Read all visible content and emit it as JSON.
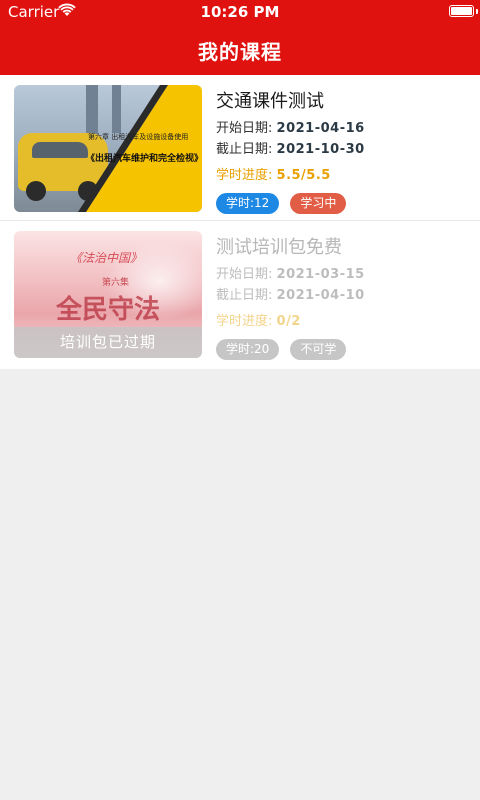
{
  "status_bar": {
    "carrier": "Carrier",
    "time": "10:26 PM"
  },
  "nav": {
    "title": "我的课程"
  },
  "colors": {
    "brand_red": "#e0120f",
    "hours_tag": "#1e88e5",
    "status_tag": "#e25d45",
    "progress": "#e9a100",
    "disabled": "#c6c6c6"
  },
  "courses": [
    {
      "title": "交通课件测试",
      "start_label": "开始日期:",
      "start_date": "2021-04-16",
      "end_label": "截止日期:",
      "end_date": "2021-10-30",
      "progress_label": "学时进度:",
      "progress_value": "5.5/5.5",
      "hours_tag": "学时:12",
      "status_tag": "学习中",
      "thumb_caption_small": "第六章 出租汽车及设施设备使用",
      "thumb_caption_main": "《出租汽车维护和完全检视》"
    },
    {
      "title": "测试培训包免费",
      "start_label": "开始日期:",
      "start_date": "2021-03-15",
      "end_label": "截止日期:",
      "end_date": "2021-04-10",
      "progress_label": "学时进度:",
      "progress_value": "0/2",
      "hours_tag": "学时:20",
      "status_tag": "不可学",
      "thumb_art_title": "《法治中国》",
      "thumb_art_episode": "第六集",
      "thumb_art_main": "全民守法",
      "expired_overlay": "培训包已过期"
    }
  ]
}
